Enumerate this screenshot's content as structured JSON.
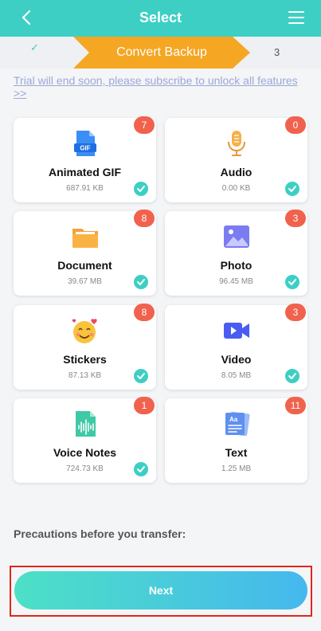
{
  "header": {
    "title": "Select",
    "back_icon": "chevron-left-icon",
    "menu_icon": "hamburger-menu-icon"
  },
  "steps": {
    "done_mark": "✓",
    "active_label": "Convert Backup",
    "next_label": "3"
  },
  "trial_notice": "Trial will end soon, please subscribe to unlock all features >>",
  "categories": [
    {
      "label": "Animated GIF",
      "size": "687.91 KB",
      "count": "7",
      "checked": true
    },
    {
      "label": "Audio",
      "size": "0.00 KB",
      "count": "0",
      "checked": true
    },
    {
      "label": "Document",
      "size": "39.67 MB",
      "count": "8",
      "checked": true
    },
    {
      "label": "Photo",
      "size": "96.45 MB",
      "count": "3",
      "checked": true
    },
    {
      "label": "Stickers",
      "size": "87.13 KB",
      "count": "8",
      "checked": true
    },
    {
      "label": "Video",
      "size": "8.05 MB",
      "count": "3",
      "checked": true
    },
    {
      "label": "Voice Notes",
      "size": "724.73 KB",
      "count": "1",
      "checked": true
    },
    {
      "label": "Text",
      "size": "1.25 MB",
      "count": "11",
      "checked": false
    }
  ],
  "precautions_label": "Precautions before you transfer:",
  "next_button_label": "Next",
  "colors": {
    "header": "#3dcfc4",
    "active_step": "#f5a623",
    "badge": "#f0624d",
    "check": "#3dcfc4"
  }
}
